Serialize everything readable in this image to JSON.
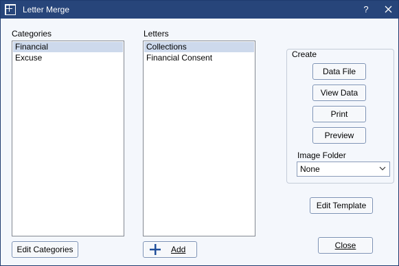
{
  "window": {
    "title": "Letter Merge",
    "help_glyph": "?",
    "close_glyph": "✕"
  },
  "categories": {
    "label": "Categories",
    "items": [
      {
        "label": "Financial",
        "selected": true
      },
      {
        "label": "Excuse",
        "selected": false
      }
    ],
    "edit_button": "Edit Categories"
  },
  "letters": {
    "label": "Letters",
    "items": [
      {
        "label": "Collections",
        "selected": true
      },
      {
        "label": "Financial Consent",
        "selected": false
      }
    ],
    "add_button": "Add"
  },
  "create": {
    "label": "Create",
    "data_file": "Data File",
    "view_data": "View Data",
    "print": "Print",
    "preview": "Preview",
    "image_folder_label": "Image Folder",
    "image_folder_value": "None"
  },
  "edit_template_button": "Edit Template",
  "close_button": "Close",
  "colors": {
    "titlebar": "#27457a",
    "selection": "#cdd9ec",
    "add_icon": "#1f4e9a"
  }
}
